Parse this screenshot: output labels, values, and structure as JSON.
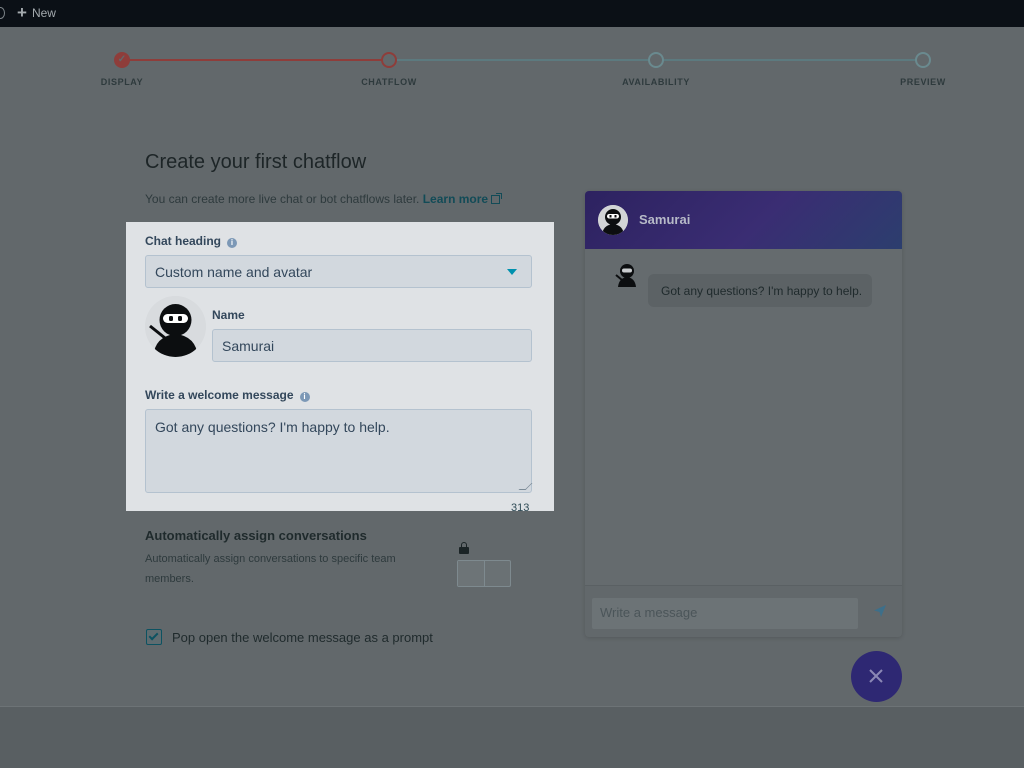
{
  "topbar": {
    "new_label": "New"
  },
  "steps": [
    {
      "label": "DISPLAY",
      "state": "complete"
    },
    {
      "label": "CHATFLOW",
      "state": "current"
    },
    {
      "label": "AVAILABILITY",
      "state": "upcoming"
    },
    {
      "label": "PREVIEW",
      "state": "upcoming"
    }
  ],
  "page": {
    "title": "Create your first chatflow",
    "subtitle": "You can create more live chat or bot chatflows later.",
    "learn_more": "Learn more"
  },
  "form": {
    "chat_heading_label": "Chat heading",
    "chat_heading_value": "Custom name and avatar",
    "name_label": "Name",
    "name_value": "Samurai",
    "welcome_label": "Write a welcome message",
    "welcome_value": "Got any questions? I'm happy to help.",
    "char_count": "313",
    "assign_title": "Automatically assign conversations",
    "assign_desc": "Automatically assign conversations to specific team members.",
    "popup_label": "Pop open the welcome message as a prompt",
    "popup_checked": true,
    "assign_enabled": false
  },
  "preview": {
    "bot_name": "Samurai",
    "welcome_bubble": "Got any questions? I'm happy to help.",
    "message_placeholder": "Write a message"
  },
  "colors": {
    "accent_step": "#8e3d3a",
    "teal_link": "#124b57",
    "header_gradient_start": "#2d2260",
    "fab": "#2e2873"
  }
}
